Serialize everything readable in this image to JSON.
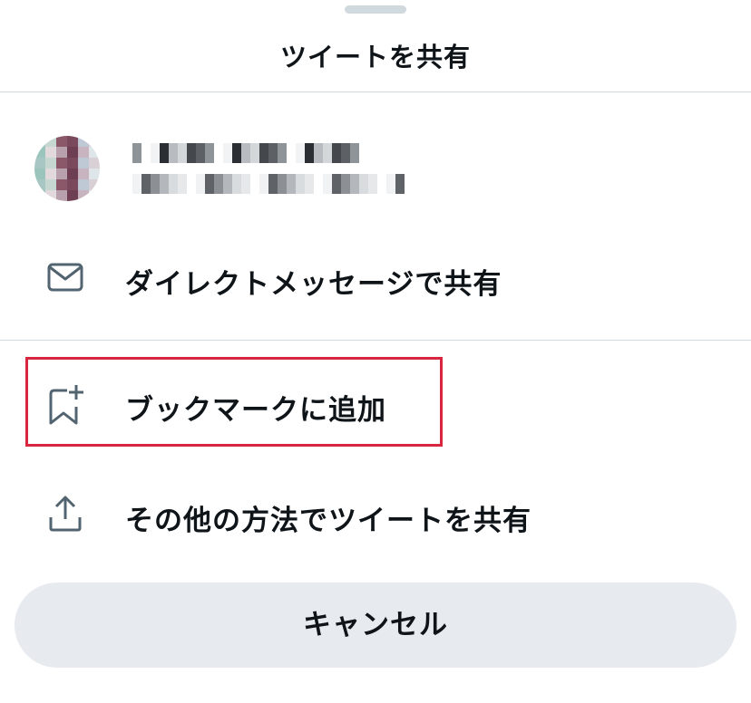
{
  "sheet": {
    "title": "ツイートを共有"
  },
  "recipient": {
    "name": "",
    "handle": ""
  },
  "options": [
    {
      "id": "dm",
      "label": "ダイレクトメッセージで共有",
      "icon": "envelope-icon"
    },
    {
      "id": "bookmark",
      "label": "ブックマークに追加",
      "icon": "bookmark-add-icon",
      "highlighted": true
    },
    {
      "id": "other",
      "label": "その他の方法でツイートを共有",
      "icon": "share-upload-icon"
    }
  ],
  "cancel_label": "キャンセル",
  "colors": {
    "highlight": "#d7263d",
    "icon": "#536471",
    "cancel_bg": "#e7eaef",
    "divider": "#cfd9de"
  }
}
